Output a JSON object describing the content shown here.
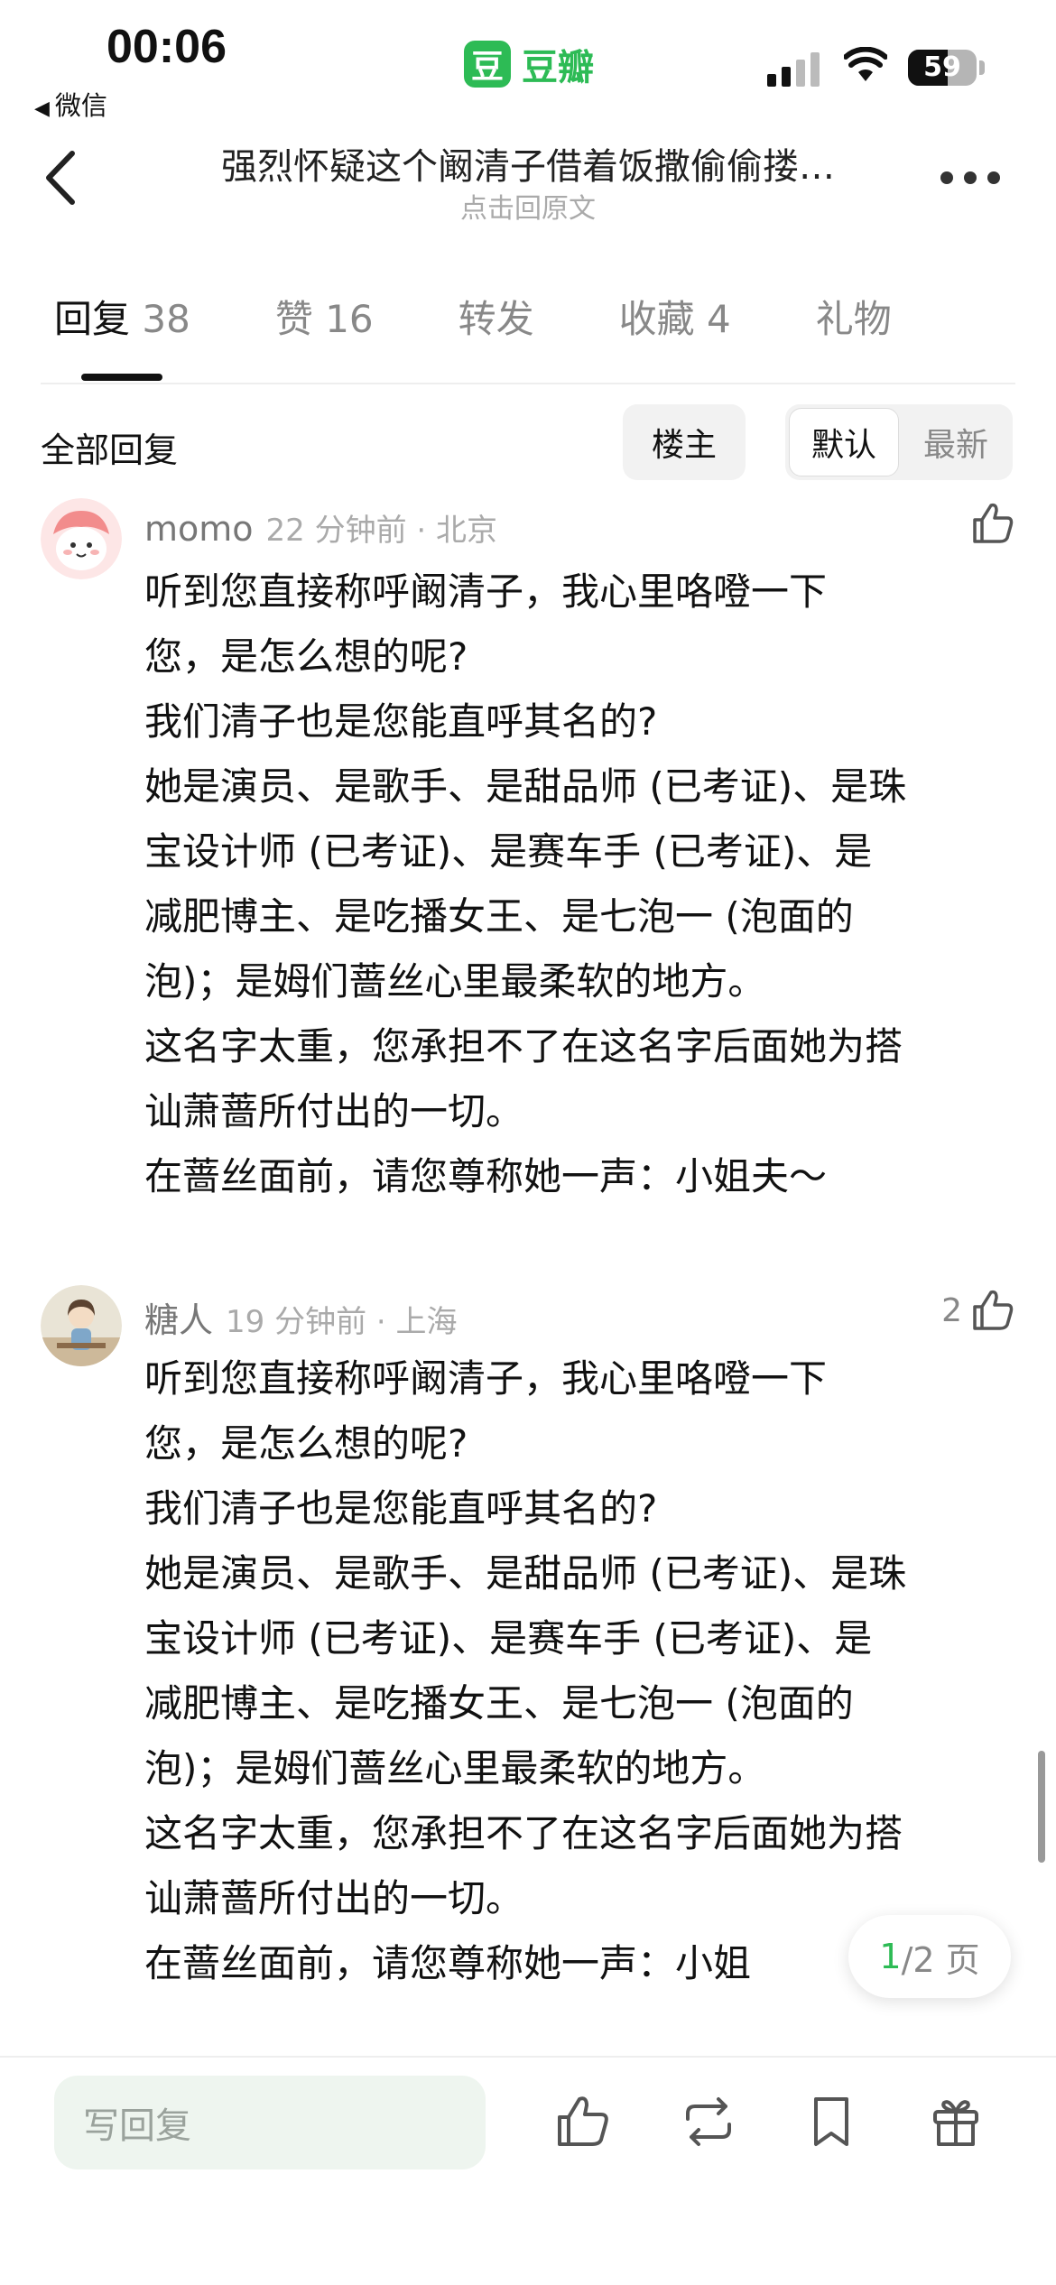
{
  "status_bar": {
    "time": "00:06",
    "back_app": "微信",
    "app_logo_char": "豆",
    "app_name": "豆瓣",
    "battery": "59"
  },
  "nav": {
    "title": "强烈怀疑这个阚清子借着饭撒偷偷搂…",
    "subtitle": "点击回原文"
  },
  "tabs": [
    {
      "label": "回复",
      "count": "38"
    },
    {
      "label": "赞",
      "count": "16"
    },
    {
      "label": "转发",
      "count": ""
    },
    {
      "label": "收藏",
      "count": "4"
    },
    {
      "label": "礼物",
      "count": ""
    }
  ],
  "filter": {
    "all_label": "全部回复",
    "op_label": "楼主",
    "sort_default": "默认",
    "sort_latest": "最新"
  },
  "comments": [
    {
      "author": "momo",
      "time_loc": "22 分钟前 · 北京",
      "likes": "",
      "lines": [
        "听到您直接称呼阚清子，我心里咯噔一下",
        "您，是怎么想的呢?",
        "我们清子也是您能直呼其名的?",
        "她是演员、是歌手、是甜品师 (已考证)、是珠",
        "宝设计师 (已考证)、是赛车手 (已考证)、是",
        "减肥博主、是吃播女王、是七泡一 (泡面的",
        "泡)；是姆们蔷丝心里最柔软的地方。",
        "这名字太重，您承担不了在这名字后面她为搭",
        "讪萧蔷所付出的一切。",
        "在蔷丝面前，请您尊称她一声：小姐夫～"
      ]
    },
    {
      "author": "糖人",
      "time_loc": "19 分钟前 · 上海",
      "likes": "2",
      "lines": [
        "听到您直接称呼阚清子，我心里咯噔一下",
        "您，是怎么想的呢?",
        "我们清子也是您能直呼其名的?",
        "她是演员、是歌手、是甜品师 (已考证)、是珠",
        "宝设计师 (已考证)、是赛车手 (已考证)、是",
        "减肥博主、是吃播女王、是七泡一 (泡面的",
        "泡)；是姆们蔷丝心里最柔软的地方。",
        "这名字太重，您承担不了在这名字后面她为搭",
        "讪萧蔷所付出的一切。",
        "在蔷丝面前，请您尊称她一声：小姐"
      ]
    }
  ],
  "pager": {
    "current": "1",
    "rest": "/2 页"
  },
  "bottom_bar": {
    "reply_placeholder": "写回复"
  }
}
